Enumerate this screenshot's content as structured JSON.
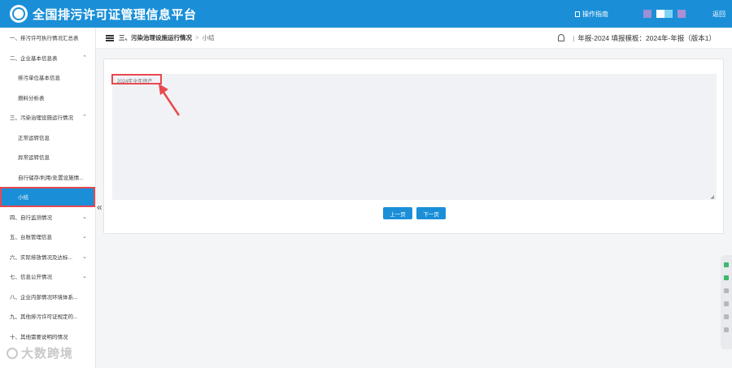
{
  "header": {
    "title": "全国排污许可证管理信息平台",
    "guide_label": "操作指南",
    "back_label": "返回",
    "swatches": [
      "#9b8fd6",
      "#ffffff",
      "#7fd3f5",
      "#a98fd4"
    ]
  },
  "sidebar": {
    "items": [
      {
        "label": "一、排污许可执行情况汇总表",
        "level": 1,
        "chevron": ""
      },
      {
        "label": "二、企业基本信息表",
        "level": 1,
        "chevron": "^"
      },
      {
        "label": "排污单位基本信息",
        "level": 2,
        "chevron": ""
      },
      {
        "label": "燃料分析表",
        "level": 2,
        "chevron": ""
      },
      {
        "label": "三、污染治理设施运行情况",
        "level": 1,
        "chevron": "^"
      },
      {
        "label": "正常运转信息",
        "level": 2,
        "chevron": ""
      },
      {
        "label": "异常运转信息",
        "level": 2,
        "chevron": ""
      },
      {
        "label": "自行储存/利用/处置设施情...",
        "level": 2,
        "chevron": ""
      },
      {
        "label": "小结",
        "level": 2,
        "chevron": "",
        "active": true
      },
      {
        "label": "四、自行监测情况",
        "level": 1,
        "chevron": "v"
      },
      {
        "label": "五、台账管理信息",
        "level": 1,
        "chevron": "v"
      },
      {
        "label": "六、实际排放情况及达标...",
        "level": 1,
        "chevron": "v"
      },
      {
        "label": "七、信息公开情况",
        "level": 1,
        "chevron": "v"
      },
      {
        "label": "八、企业内部情况环境体系...",
        "level": 1,
        "chevron": ""
      },
      {
        "label": "九、其他排污许可证规定的...",
        "level": 1,
        "chevron": ""
      },
      {
        "label": "十、其他需要说明的情况",
        "level": 1,
        "chevron": ""
      }
    ],
    "collapse_glyph": "«"
  },
  "breadcrumb": {
    "section": "三、污染治理设施运行情况",
    "separator": ">",
    "current": "小结",
    "report_info": "年报-2024 填报模板：2024年-年报（版本1）",
    "pipe": "|"
  },
  "form": {
    "textarea_placeholder": "2024年全年停产",
    "prev_label": "上一页",
    "next_label": "下一页"
  },
  "watermark": {
    "text": "大数跨境"
  },
  "colors": {
    "primary": "#1a8fd8",
    "highlight": "#e8484f"
  }
}
